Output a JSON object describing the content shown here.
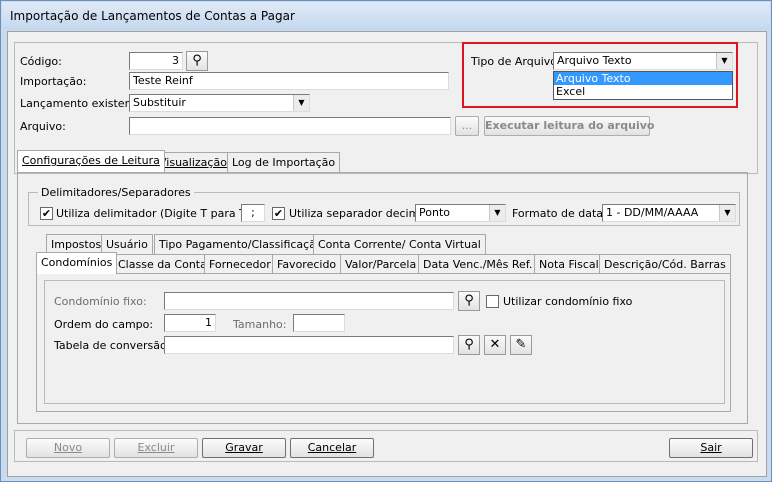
{
  "window": {
    "title": "Importação de Lançamentos de Contas a Pagar"
  },
  "header": {
    "codigo_label": "Código:",
    "codigo_value": "3",
    "importacao_label": "Importação:",
    "importacao_value": "Teste Reinf",
    "lancamento_label": "Lançamento existente:",
    "lancamento_value": "Substituir",
    "arquivo_label": "Arquivo:",
    "arquivo_value": "",
    "browse_label": "...",
    "read_button": "Executar leitura do arquivo",
    "tipo_label": "Tipo de Arquivo:",
    "tipo_value": "Arquivo Texto",
    "tipo_options": [
      "Arquivo Texto",
      "Excel"
    ]
  },
  "main_tabs": [
    "Configurações de Leitura",
    "Visualização",
    "Log de Importação"
  ],
  "delimitadores": {
    "title": "Delimitadores/Separadores",
    "usa_delim_label": "Utiliza delimitador (Digite T para TAB)",
    "delim_value": ";",
    "usa_sep_label": "Utiliza separador decimal",
    "sep_value": "Ponto",
    "formato_label": "Formato de data:",
    "formato_value": "1 - DD/MM/AAAA"
  },
  "inner_tabs_row1": [
    "Impostos",
    "Usuário",
    "Tipo Pagamento/Classificação",
    "Conta Corrente/ Conta Virtual"
  ],
  "inner_tabs_row2": [
    "Condomínios",
    "Classe da Conta",
    "Fornecedor",
    "Favorecido",
    "Valor/Parcela",
    "Data Venc./Mês Ref.",
    "Nota Fiscal",
    "Descrição/Cód. Barras"
  ],
  "condominios": {
    "fixo_label": "Condomínio fixo:",
    "fixo_value": "",
    "usar_fixo_label": "Utilizar condomínio fixo",
    "ordem_label": "Ordem do campo:",
    "ordem_value": "1",
    "tamanho_label": "Tamanho:",
    "tamanho_value": "",
    "tabela_label": "Tabela de conversão:",
    "tabela_value": ""
  },
  "footer": {
    "novo": "Novo",
    "excluir": "Excluir",
    "gravar": "Gravar",
    "cancelar": "Cancelar",
    "sair": "Sair"
  }
}
